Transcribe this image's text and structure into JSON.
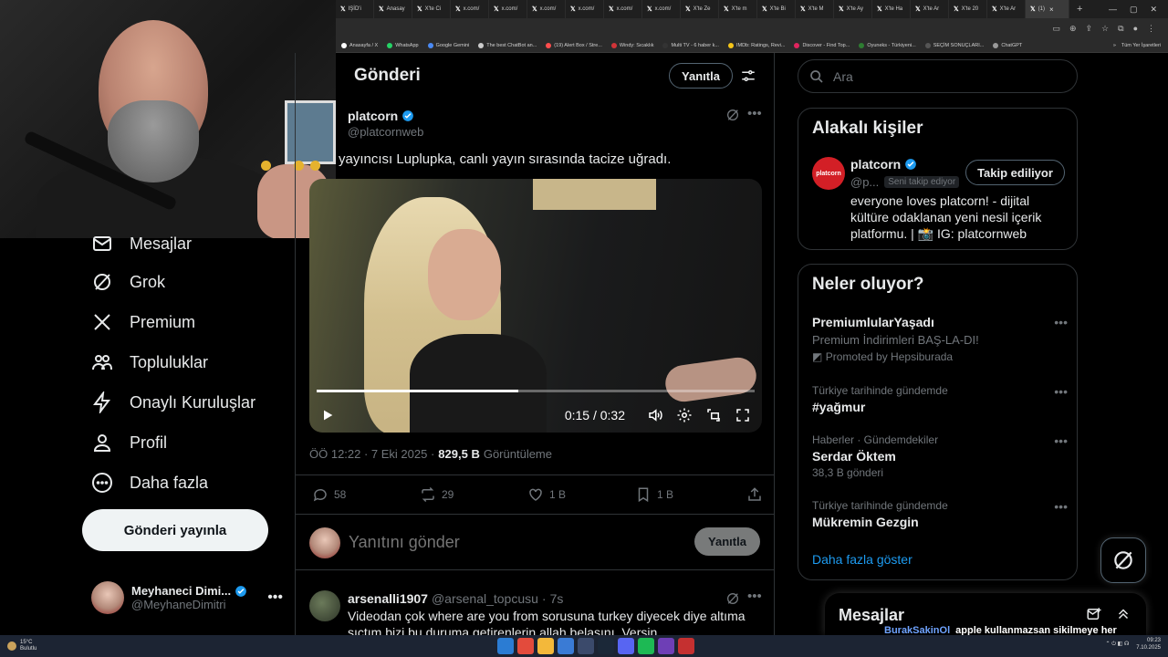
{
  "browser": {
    "tabs": [
      {
        "label": "IŞİD'i"
      },
      {
        "label": "Anasay"
      },
      {
        "label": "X'te Ci"
      },
      {
        "label": "x.com/"
      },
      {
        "label": "x.com/"
      },
      {
        "label": "x.com/"
      },
      {
        "label": "x.com/"
      },
      {
        "label": "x.com/"
      },
      {
        "label": "x.com/"
      },
      {
        "label": "X'te Ze"
      },
      {
        "label": "X'te m"
      },
      {
        "label": "X'te Bi"
      },
      {
        "label": "X'te M"
      },
      {
        "label": "X'te Ay"
      },
      {
        "label": "X'te Ha"
      },
      {
        "label": "X'te Ar"
      },
      {
        "label": "X'te 20"
      },
      {
        "label": "X'te Ar"
      }
    ],
    "active_tab": {
      "label": "(1)"
    },
    "bookmarks": [
      {
        "label": "Anasayfa / X",
        "color": "#ffffff"
      },
      {
        "label": "WhatsApp",
        "color": "#25d366"
      },
      {
        "label": "Google Gemini",
        "color": "#4a8af4"
      },
      {
        "label": "The best ChatBot an...",
        "color": "#cccccc"
      },
      {
        "label": "(19) Alert Box / Stre...",
        "color": "#ff4d4d"
      },
      {
        "label": "Windy: Sıcaklık",
        "color": "#d13438"
      },
      {
        "label": "Multi TV - 6 haber k...",
        "color": "#333333"
      },
      {
        "label": "IMDb: Ratings, Revi...",
        "color": "#f5c518"
      },
      {
        "label": "Discover - Find Top...",
        "color": "#e0245e"
      },
      {
        "label": "Oyuneks - Türkiyeni...",
        "color": "#2e7d32"
      },
      {
        "label": "SEÇİM SONUÇLARI...",
        "color": "#555555"
      },
      {
        "label": "ChatGPT",
        "color": "#999999"
      }
    ],
    "bookmarks_more": "»",
    "bookmarks_folder": "Tüm Yer İşaretleri"
  },
  "sidebar": {
    "items": [
      {
        "label": "Mesajlar",
        "icon": "mail-icon"
      },
      {
        "label": "Grok",
        "icon": "grok-icon"
      },
      {
        "label": "Premium",
        "icon": "x-logo-icon"
      },
      {
        "label": "Topluluklar",
        "icon": "people-icon"
      },
      {
        "label": "Onaylı Kuruluşlar",
        "icon": "lightning-icon"
      },
      {
        "label": "Profil",
        "icon": "person-icon"
      },
      {
        "label": "Daha fazla",
        "icon": "more-circle-icon"
      }
    ],
    "post_button": "Gönderi yayınla",
    "account": {
      "name": "Meyhaneci Dimi...",
      "handle": "@MeyhaneDimitri",
      "more": "•••"
    }
  },
  "main": {
    "title": "Gönderi",
    "reply_pill": "Yanıtla",
    "tweet": {
      "name": "platcorn",
      "handle": "@platcornweb",
      "text": "yayıncısı Luplupka, canlı yayın sırasında tacize uğradı.",
      "video": {
        "time": "0:15 / 0:32",
        "progress": 0.46
      },
      "date": "ÖÖ 12:22 · 7 Eki 2025 ·",
      "views_num": "829,5 B",
      "views_label": "Görüntüleme",
      "actions": {
        "replies": "58",
        "reposts": "29",
        "likes": "1 B",
        "bookmarks": "1 B"
      }
    },
    "reply_box": {
      "placeholder": "Yanıtını gönder",
      "button": "Yanıtla"
    },
    "reply_tweet": {
      "name": "arsenalli1907",
      "handle": "@arsenal_topcusu",
      "sep": "·",
      "time": "7s",
      "text": "Videodan çok where are you from sorusuna turkey diyecek diye altıma sıçtım bizi bu duruma getirenlerin allah belasını. Versin"
    }
  },
  "right": {
    "search_placeholder": "Ara",
    "related": {
      "title": "Alakalı kişiler",
      "avatar_text": "platcorn",
      "name": "platcorn",
      "handle": "@p...",
      "follows_you": "Seni takip ediyor",
      "follow_button": "Takip ediliyor",
      "bio": "everyone loves platcorn! - dijital kültüre odaklanan yeni nesil içerik platformu. | 📸 IG: platcornweb"
    },
    "trends": {
      "title": "Neler oluyor?",
      "promoted": {
        "title": "PremiumlularYaşadı",
        "subtitle": "Premium İndirimleri BAŞ-LA-DI!",
        "by": "Promoted by Hepsiburada"
      },
      "items": [
        {
          "context": "Türkiye tarihinde gündemde",
          "title": "#yağmur",
          "sub": ""
        },
        {
          "context": "Haberler · Gündemdekiler",
          "title": "Serdar Öktem",
          "sub": "38,3 B gönderi"
        },
        {
          "context": "Türkiye tarihinde gündemde",
          "title": "Mükremin Gezgin",
          "sub": ""
        }
      ],
      "show_more": "Daha fazla göster",
      "more": "•••"
    }
  },
  "messages": {
    "title": "Mesajlar"
  },
  "stream_chat": {
    "user": "BurakSakinOl",
    "text": "apple kullanmazsan sikilmeye her zaman layıksın"
  },
  "taskbar": {
    "temp": "15°C",
    "weather": "Bulutlu",
    "time": "09:23",
    "date": "7.10.2025"
  },
  "colors": {
    "accent": "#1d9bf0",
    "bg": "#000000",
    "border": "#2f3336",
    "muted": "#71767b"
  }
}
